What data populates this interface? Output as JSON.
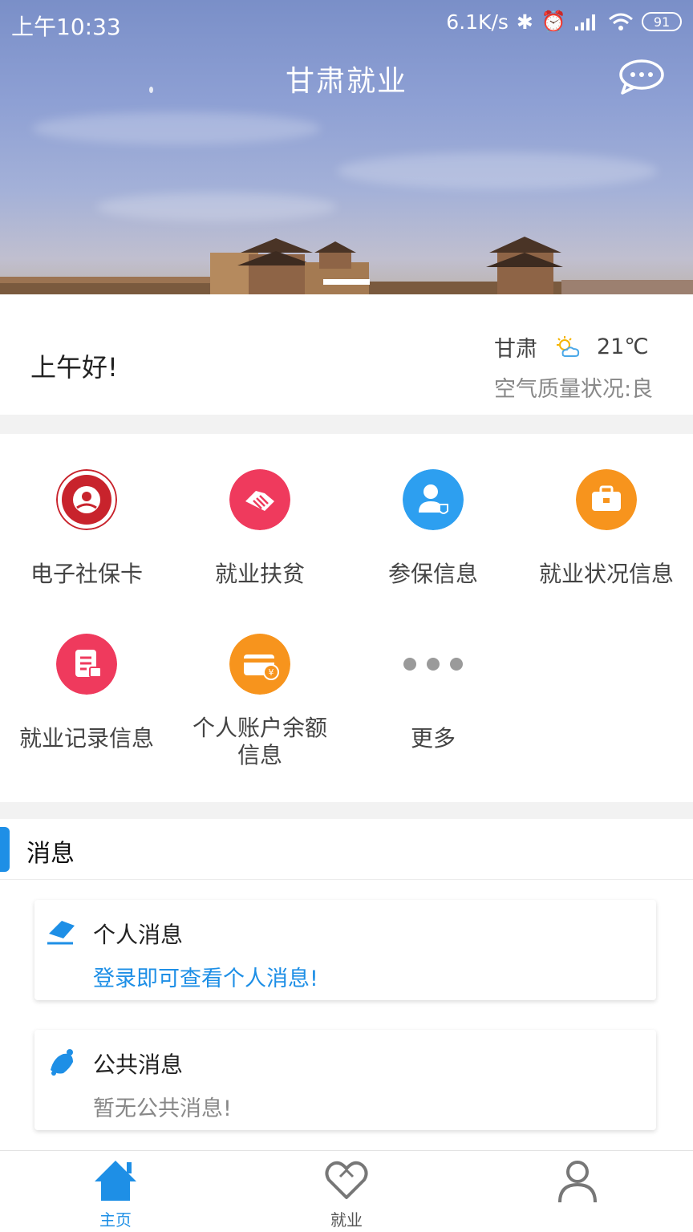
{
  "status_bar": {
    "time": "上午10:33",
    "speed": "6.1K/s",
    "battery": "91"
  },
  "header": {
    "title": "甘肃就业"
  },
  "greeting": {
    "hello": "上午好!",
    "city": "甘肃",
    "temperature": "21℃",
    "air_quality": "空气质量状况:良",
    "weather_icon": "partly-cloudy-icon"
  },
  "services": [
    {
      "label": "电子社保卡",
      "icon": "social-security-card-icon",
      "color": "#c8232c"
    },
    {
      "label": "就业扶贫",
      "icon": "handshake-icon",
      "color": "#ef3a5d"
    },
    {
      "label": "参保信息",
      "icon": "user-shield-icon",
      "color": "#2d9ff0"
    },
    {
      "label": "就业状况信息",
      "icon": "briefcase-icon",
      "color": "#f7941d"
    },
    {
      "label": "就业记录信息",
      "icon": "clipboard-icon",
      "color": "#ef3a5d"
    },
    {
      "label": "个人账户余额\n信息",
      "icon": "yuan-card-icon",
      "color": "#f7941d"
    },
    {
      "label": "更多",
      "icon": "more-dots-icon",
      "color": "#9a9a9a"
    }
  ],
  "messages": {
    "title": "消息",
    "personal": {
      "title": "个人消息",
      "text": "登录即可查看个人消息!",
      "text_color": "#1e8fe6"
    },
    "public": {
      "title": "公共消息",
      "text": "暂无公共消息!",
      "text_color": "#888888"
    }
  },
  "bottom_nav": [
    {
      "label": "主页",
      "active": true
    },
    {
      "label": "就业",
      "active": false
    },
    {
      "label": "",
      "active": false
    }
  ],
  "colors": {
    "accent": "#1e8fe6"
  }
}
